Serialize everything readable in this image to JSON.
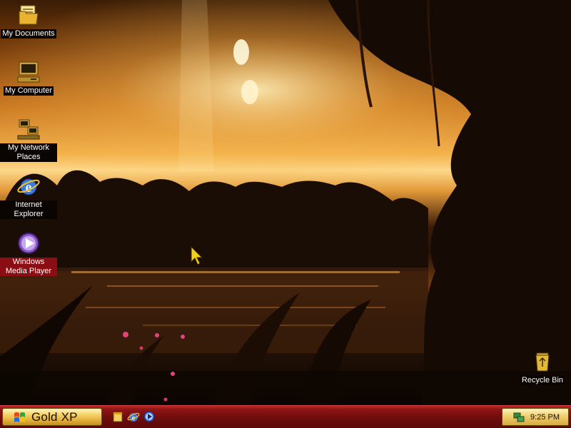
{
  "desktop": {
    "icons": [
      {
        "label": "My Documents"
      },
      {
        "label": "My Computer"
      },
      {
        "label": "My Network Places"
      },
      {
        "label": "Internet Explorer"
      },
      {
        "label": "Windows Media Player"
      },
      {
        "label": "Recycle Bin"
      }
    ],
    "selected_icon": "Windows Media Player"
  },
  "taskbar": {
    "start_label": "Gold XP",
    "quick_launch": [
      "show-desktop-icon",
      "internet-explorer-icon",
      "media-player-icon"
    ],
    "clock": "9:25 PM"
  },
  "theme": {
    "taskbar_color": "#7a1010",
    "start_button_color": "#e8b84a",
    "selection_color": "#8a0e14"
  }
}
